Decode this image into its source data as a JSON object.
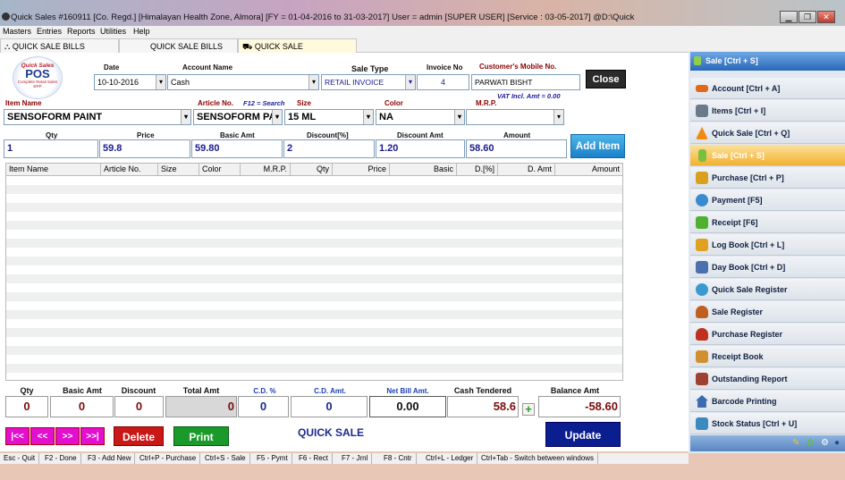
{
  "window": {
    "title": "Quick Sales #160911  [Co. Regd.]  [Himalayan Health Zone, Almora] [FY = 01-04-2016 to 31-03-2017] User = admin [SUPER USER]  [Service : 03-05-2017]  @D:\\Quick"
  },
  "menu": [
    "Masters",
    "Entries",
    "Reports",
    "Utilities",
    "Help"
  ],
  "tabs": [
    {
      "label": "QUICK SALE BILLS"
    },
    {
      "label": "QUICK SALE BILLS"
    },
    {
      "label": "QUICK SALE"
    }
  ],
  "logo": {
    "line1": "Quick Sales",
    "line2": "POS",
    "line3": "Complete Retail Sales ERP"
  },
  "form": {
    "date_label": "Date",
    "date": "10-10-2016",
    "account_label": "Account Name",
    "account": "Cash",
    "sale_type_label": "Sale Type",
    "sale_type": "RETAIL INVOICE",
    "invoice_label": "Invoice No",
    "invoice": "4",
    "mobile_label": "Customer's Mobile No.",
    "customer": "PARWATI BISHT",
    "vat_note": "VAT Incl. Amt = 0.00",
    "close": "Close",
    "item_name_label": "Item Name",
    "item_name": "SENSOFORM PAINT",
    "article_label": "Article No.",
    "f12_note": "F12 = Search",
    "article": "SENSOFORM PAII",
    "size_label": "Size",
    "size": "15 ML",
    "color_label": "Color",
    "color": "NA",
    "mrp_label": "M.R.P.",
    "mrp": "",
    "qty_label": "Qty",
    "qty": "1",
    "price_label": "Price",
    "price": "59.8",
    "basic_label": "Basic Amt",
    "basic": "59.80",
    "disc_label": "Discount[%]",
    "disc": "2",
    "disc_amt_label": "Discount Amt",
    "disc_amt": "1.20",
    "amount_label": "Amount",
    "amount": "58.60",
    "add_item": "Add Item"
  },
  "grid": {
    "columns": [
      "Item Name",
      "Article No.",
      "Size",
      "Color",
      "M.R.P.",
      "Qty",
      "Price",
      "Basic",
      "D.[%]",
      "D. Amt",
      "Amount"
    ],
    "rows": []
  },
  "totals": {
    "qty_label": "Qty",
    "qty": "0",
    "basic_label": "Basic Amt",
    "basic": "0",
    "discount_label": "Discount",
    "discount": "0",
    "total_label": "Total Amt",
    "total": "0",
    "cd_pct_label": "C.D. %",
    "cd_pct": "0",
    "cd_amt_label": "C.D. Amt.",
    "cd_amt": "0",
    "net_label": "Net Bill Amt.",
    "net": "0.00",
    "cash_label": "Cash Tendered",
    "cash": "58.6",
    "balance_label": "Balance Amt",
    "balance": "-58.60"
  },
  "actions": {
    "first": "|<<",
    "prev": "<<",
    "next": ">>",
    "last": ">>|",
    "delete": "Delete",
    "print": "Print",
    "mode": "QUICK SALE",
    "update": "Update"
  },
  "status": [
    "Esc - Quit",
    "F2 - Done",
    "F3 - Add New",
    "Ctrl+P - Purchase",
    "Ctrl+S - Sale",
    "F5 - Pymt",
    "F6 - Rect",
    "F7 - Jrnl",
    "F8 - Cntr",
    "Ctrl+L - Ledger",
    "Ctrl+Tab - Switch between windows"
  ],
  "sidebar": {
    "header": "Sale [Ctrl + S]",
    "items": [
      {
        "label": "Account [Ctrl + A]",
        "icon": "account-icon",
        "color": "#e06a1a"
      },
      {
        "label": "Items [Ctrl + I]",
        "icon": "items-icon",
        "color": "#6a7a8a"
      },
      {
        "label": "Quick Sale [Ctrl + Q]",
        "icon": "cone-icon",
        "color": "#f08a10"
      },
      {
        "label": "Sale [Ctrl + S]",
        "icon": "sale-icon",
        "color": "#7ac040"
      },
      {
        "label": "Purchase [Ctrl + P]",
        "icon": "purchase-icon",
        "color": "#d9a020"
      },
      {
        "label": "Payment [F5]",
        "icon": "payment-icon",
        "color": "#3a8ad0"
      },
      {
        "label": "Receipt [F6]",
        "icon": "receipt-icon",
        "color": "#50b030"
      },
      {
        "label": "Log Book [Ctrl + L]",
        "icon": "logbook-icon",
        "color": "#e0a020"
      },
      {
        "label": "Day Book [Ctrl + D]",
        "icon": "daybook-icon",
        "color": "#4a70b0"
      },
      {
        "label": "Quick Sale Register",
        "icon": "globe-icon",
        "color": "#3a9ad0"
      },
      {
        "label": "Sale Register",
        "icon": "user-icon",
        "color": "#c06020"
      },
      {
        "label": "Purchase Register",
        "icon": "user-red-icon",
        "color": "#c03020"
      },
      {
        "label": "Receipt Book",
        "icon": "receipt-book-icon",
        "color": "#d09030"
      },
      {
        "label": "Outstanding Report",
        "icon": "report-icon",
        "color": "#a04030"
      },
      {
        "label": "Barcode Printing",
        "icon": "home-icon",
        "color": "#3a6ab0"
      },
      {
        "label": "Stock Status [Ctrl + U]",
        "icon": "stock-icon",
        "color": "#3a8ac0"
      }
    ]
  }
}
